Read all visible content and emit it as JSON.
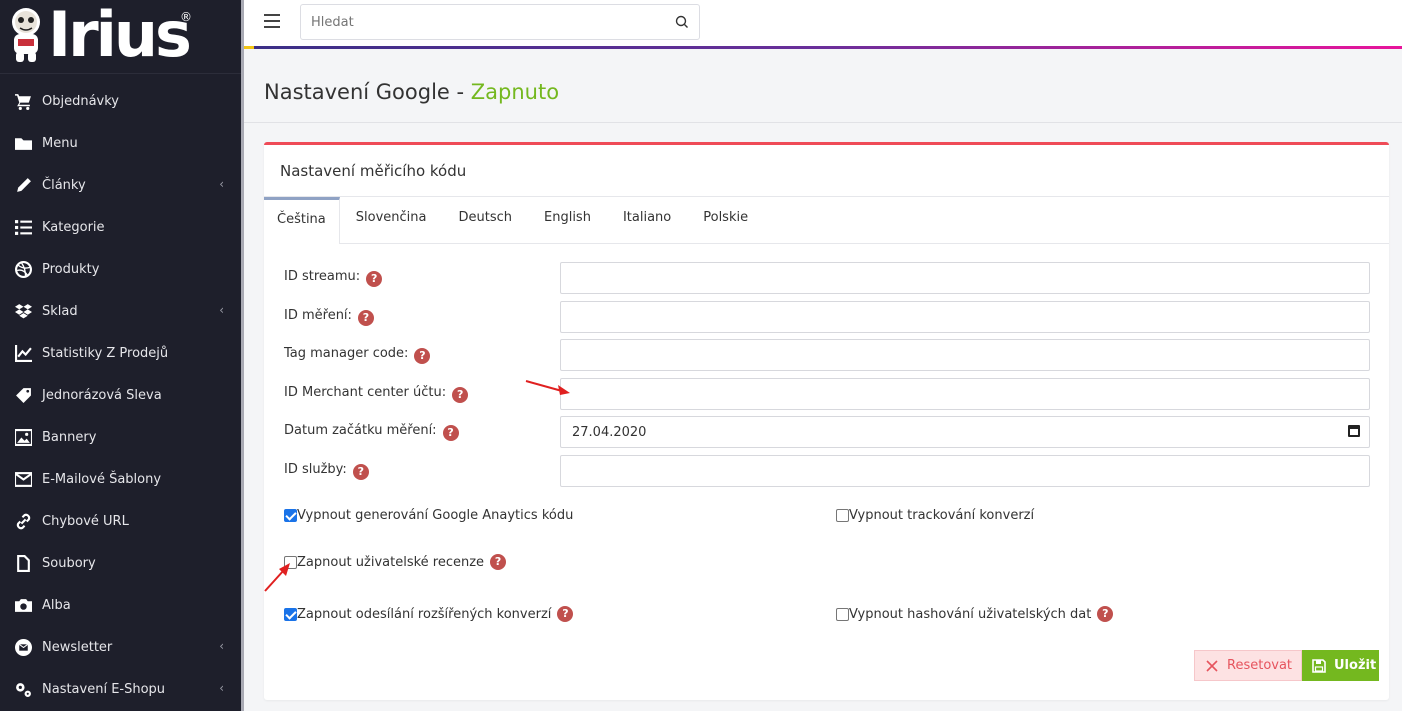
{
  "brand": {
    "name": "Irius",
    "reg": "®"
  },
  "sidebar": {
    "items": [
      {
        "label": "Objednávky",
        "icon": "cart-icon",
        "submenu": false
      },
      {
        "label": "Menu",
        "icon": "folder-icon",
        "submenu": false
      },
      {
        "label": "Články",
        "icon": "pencil-icon",
        "submenu": true
      },
      {
        "label": "Kategorie",
        "icon": "list-icon",
        "submenu": false
      },
      {
        "label": "Produkty",
        "icon": "dribbble-icon",
        "submenu": false
      },
      {
        "label": "Sklad",
        "icon": "dropbox-icon",
        "submenu": true
      },
      {
        "label": "Statistiky Z Prodejů",
        "icon": "chart-icon",
        "submenu": false
      },
      {
        "label": "Jednorázová Sleva",
        "icon": "tag-icon",
        "submenu": false
      },
      {
        "label": "Bannery",
        "icon": "image-icon",
        "submenu": false
      },
      {
        "label": "E-Mailové Šablony",
        "icon": "envelope-icon",
        "submenu": false
      },
      {
        "label": "Chybové URL",
        "icon": "link-icon",
        "submenu": false
      },
      {
        "label": "Soubory",
        "icon": "file-icon",
        "submenu": false
      },
      {
        "label": "Alba",
        "icon": "camera-icon",
        "submenu": false
      },
      {
        "label": "Newsletter",
        "icon": "envelope-circle-icon",
        "submenu": true
      },
      {
        "label": "Nastavení E-Shopu",
        "icon": "gears-icon",
        "submenu": true
      }
    ]
  },
  "topbar": {
    "search_placeholder": "Hledat"
  },
  "page": {
    "title": "Nastavení Google - ",
    "status": "Zapnuto"
  },
  "card": {
    "title": "Nastavení měřicího kódu",
    "tabs": [
      "Čeština",
      "Slovenčina",
      "Deutsch",
      "English",
      "Italiano",
      "Polskie"
    ],
    "active_tab": 0,
    "fields": [
      {
        "label": "ID streamu:",
        "value": ""
      },
      {
        "label": "ID měření:",
        "value": ""
      },
      {
        "label": "Tag manager code:",
        "value": ""
      },
      {
        "label": "ID Merchant center účtu:",
        "value": ""
      },
      {
        "label": "Datum začátku měření:",
        "value": "27.04.2020"
      },
      {
        "label": "ID služby:",
        "value": ""
      }
    ],
    "checkboxes": [
      {
        "label": "Vypnout generování Google Anaytics kódu",
        "checked": true,
        "help": false
      },
      {
        "label": "Vypnout trackování konverzí",
        "checked": false,
        "help": false
      },
      {
        "label": "Zapnout uživatelské recenze",
        "checked": false,
        "help": true
      },
      {
        "label": "Zapnout odesílání rozšířených konverzí",
        "checked": true,
        "help": true
      },
      {
        "label": "Vypnout hashování uživatelských dat",
        "checked": false,
        "help": true
      }
    ],
    "buttons": {
      "reset": "Resetovat",
      "save": "Uložit"
    }
  },
  "colors": {
    "accent_green": "#74b81f",
    "accent_red": "#ef4b57",
    "sidebar_bg": "#1e1f2b",
    "annotation_arrow": "#e02020"
  }
}
